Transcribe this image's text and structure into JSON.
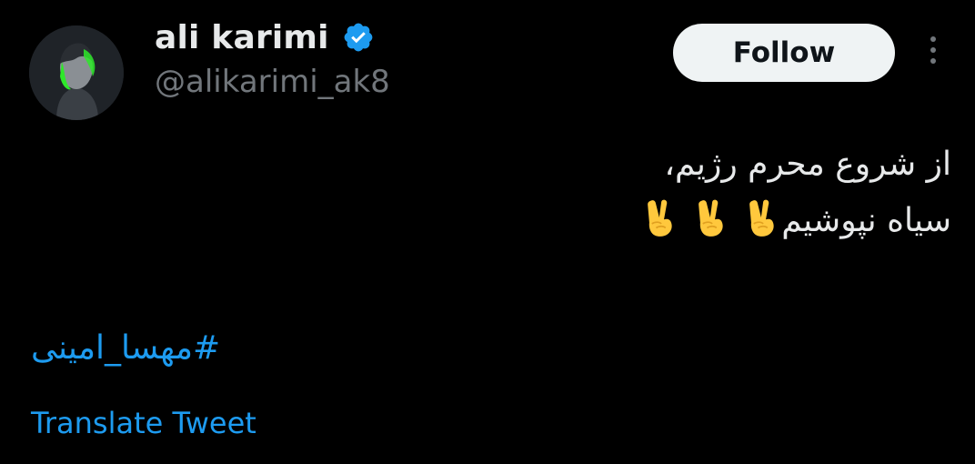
{
  "author": {
    "name": "ali karimi",
    "handle": "@alikarimi_ak8",
    "verified": true,
    "avatar_icon": "profile-photo"
  },
  "actions": {
    "follow_label": "Follow",
    "more_icon": "more-vertical-icon"
  },
  "tweet": {
    "line1": "از شروع محرم رژیم،",
    "line2": "سیاه نپوشیم",
    "emoji_count": 3,
    "emoji_icon": "victory-hand-emoji",
    "hashtag": "#مهسا_امینی",
    "translate_label": "Translate Tweet"
  },
  "colors": {
    "background": "#000000",
    "text": "#e7e9ea",
    "secondary": "#71767b",
    "link": "#1d9bf0",
    "verified": "#1d9bf0",
    "follow_bg": "#eff3f4"
  }
}
